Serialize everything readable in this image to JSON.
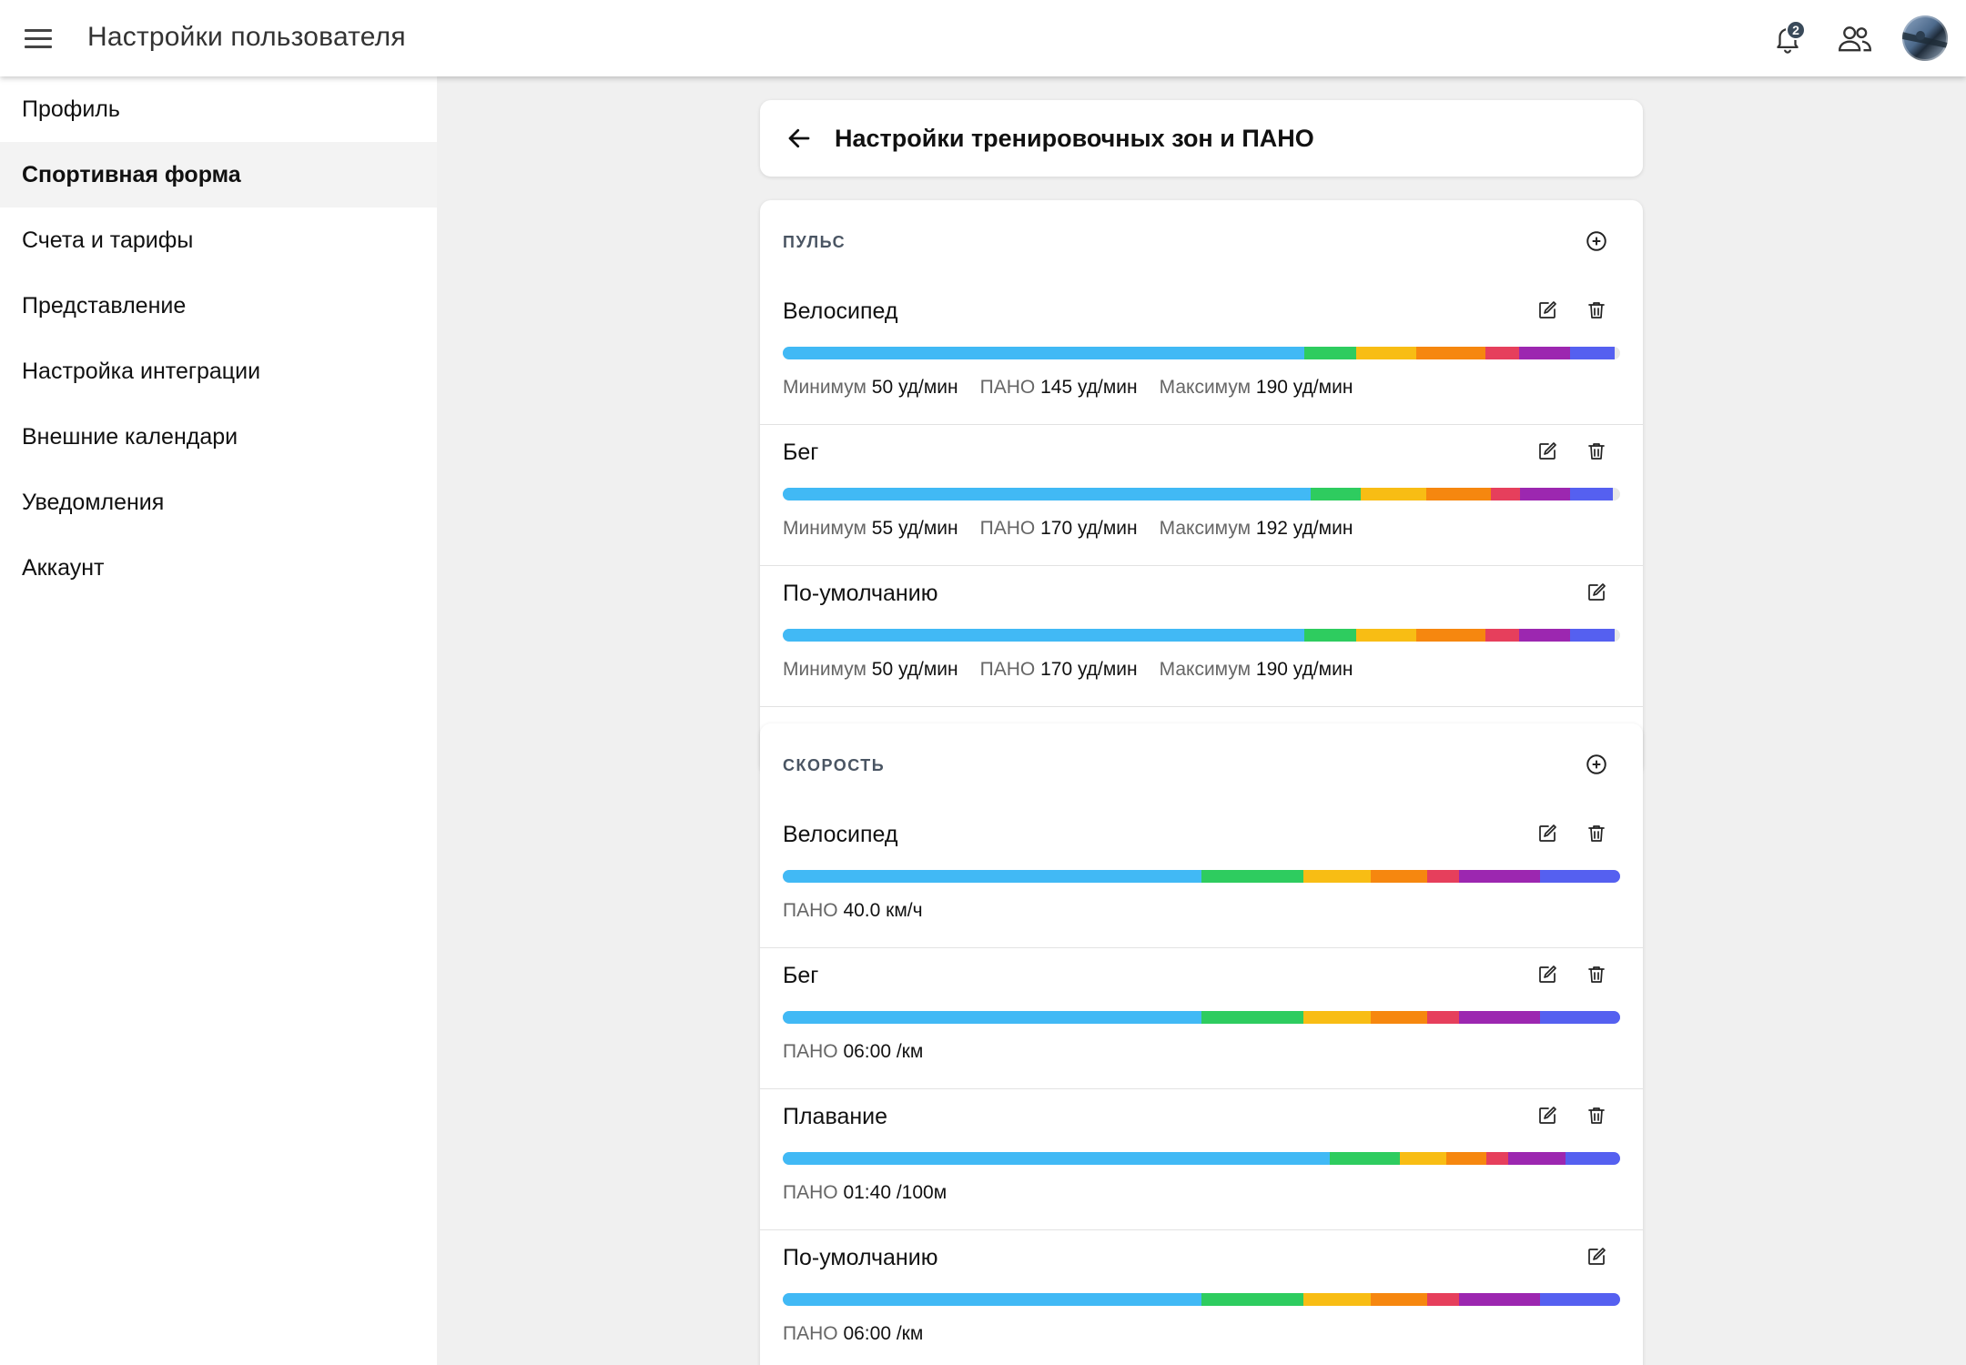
{
  "app": {
    "title": "Настройки пользователя",
    "notifications_count": "2"
  },
  "sidebar": {
    "items": [
      {
        "label": "Профиль"
      },
      {
        "label": "Спортивная форма"
      },
      {
        "label": "Счета и тарифы"
      },
      {
        "label": "Представление"
      },
      {
        "label": "Настройка интеграции"
      },
      {
        "label": "Внешние календари"
      },
      {
        "label": "Уведомления"
      },
      {
        "label": "Аккаунт"
      }
    ],
    "active_index": 1
  },
  "page": {
    "title": "Настройки тренировочных зон и ПАНО"
  },
  "zone_colors": [
    "#41b9f5",
    "#2ecc5f",
    "#f8bd14",
    "#f6870f",
    "#e63f5c",
    "#9c27b0",
    "#5560f0"
  ],
  "labels": {
    "min": "Минимум",
    "threshold": "ПАНО",
    "max": "Максимум"
  },
  "pulse": {
    "label": "ПУЛЬС",
    "rows": [
      {
        "name": "Велосипед",
        "min": "50 уд/мин",
        "threshold": "145 уд/мин",
        "max": "190 уд/мин",
        "deletable": true,
        "zone_fractions": [
          0.623,
          0.062,
          0.072,
          0.082,
          0.04,
          0.061,
          0.053
        ]
      },
      {
        "name": "Бег",
        "min": "55 уд/мин",
        "threshold": "170 уд/мин",
        "max": "192 уд/мин",
        "deletable": true,
        "zone_fractions": [
          0.63,
          0.06,
          0.078,
          0.078,
          0.034,
          0.06,
          0.051
        ]
      },
      {
        "name": "По-умолчанию",
        "min": "50 уд/мин",
        "threshold": "170 уд/мин",
        "max": "190 уд/мин",
        "deletable": false,
        "zone_fractions": [
          0.623,
          0.062,
          0.072,
          0.082,
          0.04,
          0.061,
          0.053
        ]
      }
    ]
  },
  "speed": {
    "label": "СКОРОСТЬ",
    "rows": [
      {
        "name": "Велосипед",
        "threshold": "40.0 км/ч",
        "deletable": true,
        "zone_fractions": [
          0.5,
          0.122,
          0.08,
          0.068,
          0.038,
          0.096,
          0.096
        ]
      },
      {
        "name": "Бег",
        "threshold": "06:00 /км",
        "deletable": true,
        "zone_fractions": [
          0.5,
          0.122,
          0.08,
          0.068,
          0.038,
          0.096,
          0.096
        ]
      },
      {
        "name": "Плавание",
        "threshold": "01:40 /100м",
        "deletable": true,
        "zone_fractions": [
          0.653,
          0.084,
          0.055,
          0.048,
          0.026,
          0.069,
          0.065
        ]
      },
      {
        "name": "По-умолчанию",
        "threshold": "06:00 /км",
        "deletable": false,
        "zone_fractions": [
          0.5,
          0.122,
          0.08,
          0.068,
          0.038,
          0.096,
          0.096
        ]
      }
    ]
  }
}
